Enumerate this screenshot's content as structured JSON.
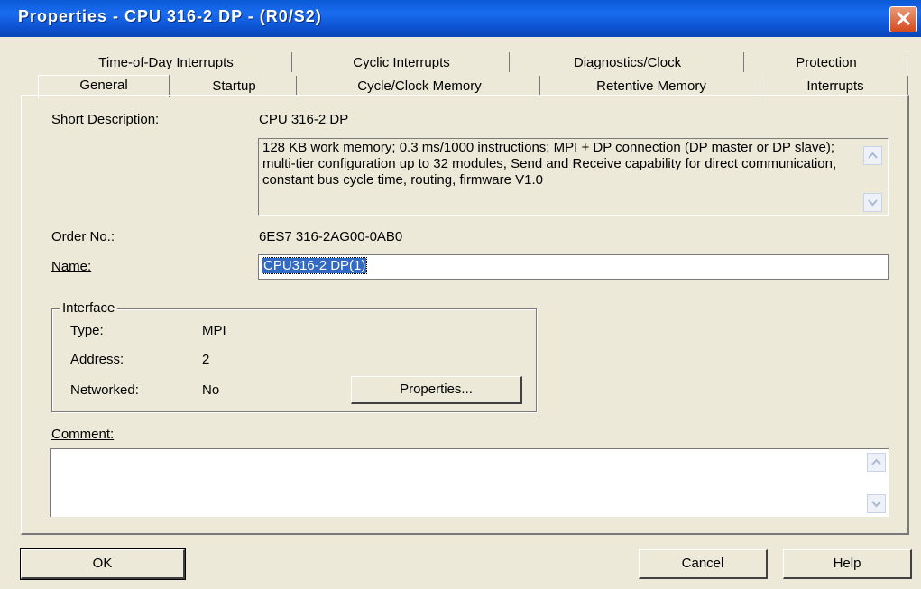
{
  "window": {
    "title": "Properties - CPU 316-2 DP - (R0/S2)"
  },
  "tabs_row1": [
    "Time-of-Day Interrupts",
    "Cyclic Interrupts",
    "Diagnostics/Clock",
    "Protection"
  ],
  "tabs_row2": [
    "General",
    "Startup",
    "Cycle/Clock Memory",
    "Retentive Memory",
    "Interrupts"
  ],
  "active_tab": "General",
  "general": {
    "short_description_label": "Short Description:",
    "short_description_value": "CPU 316-2 DP",
    "description_text": "128 KB work memory; 0.3 ms/1000 instructions; MPI + DP connection (DP master or DP slave); multi-tier configuration up to 32 modules, Send and Receive capability for direct communication, constant bus cycle time, routing, firmware V1.0",
    "order_no_label": "Order No.:",
    "order_no_value": "6ES7 316-2AG00-0AB0",
    "name_label": "Name:",
    "name_value": "CPU316-2 DP(1)",
    "interface": {
      "legend": "Interface",
      "type_label": "Type:",
      "type_value": "MPI",
      "address_label": "Address:",
      "address_value": "2",
      "networked_label": "Networked:",
      "networked_value": "No",
      "properties_button": "Properties..."
    },
    "comment_label": "Comment:",
    "comment_value": ""
  },
  "buttons": {
    "ok": "OK",
    "cancel": "Cancel",
    "help": "Help"
  },
  "icons": {
    "close": "close-icon",
    "scroll_up": "scroll-up-icon",
    "scroll_down": "scroll-down-icon"
  },
  "colors": {
    "titlebar": "#0a5ad6",
    "dialog_bg": "#ece9d8",
    "selection": "#316ac5",
    "close_button": "#d5491d"
  }
}
